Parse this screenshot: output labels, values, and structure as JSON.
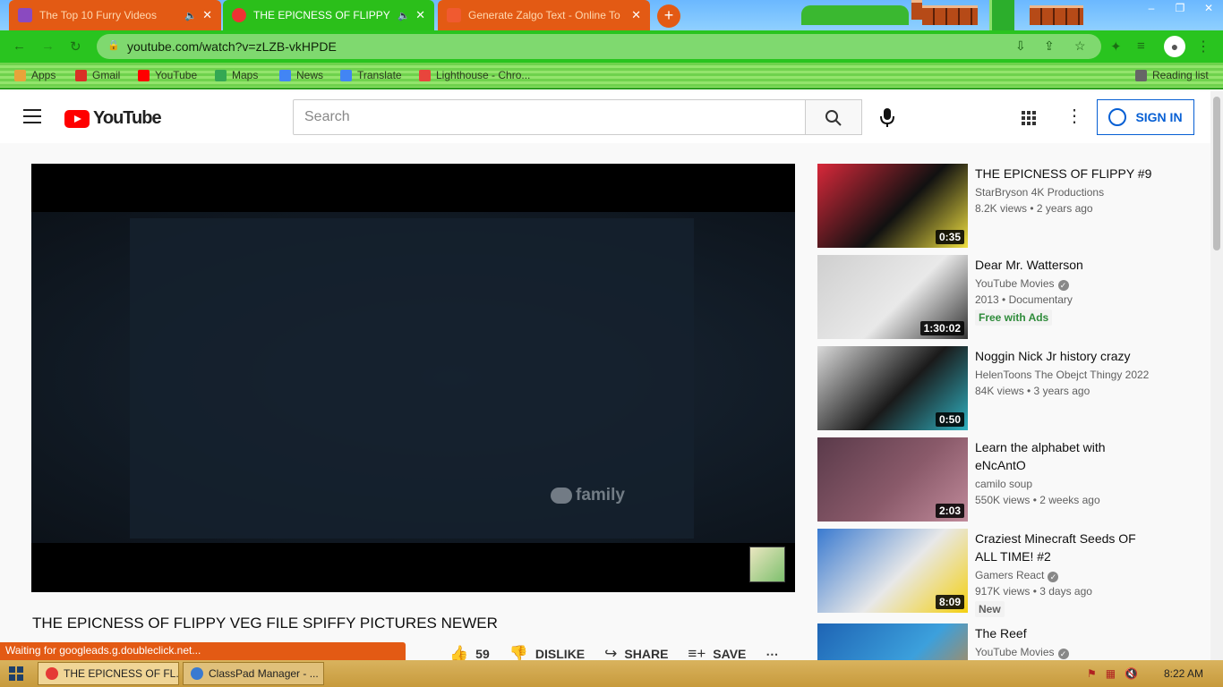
{
  "browser": {
    "tabs": [
      {
        "title": "The Top 10 Furry Videos",
        "audio": true
      },
      {
        "title": "THE EPICNESS OF FLIPPY VEG",
        "audio": true
      },
      {
        "title": "Generate Zalgo Text - Online To"
      }
    ],
    "new_tab_symbol": "+",
    "window_controls": {
      "minimize": "–",
      "restore": "❐",
      "close": "✕"
    },
    "url": "youtube.com/watch?v=zLZB-vkHPDE",
    "bookmarks": [
      {
        "label": "Apps",
        "color": "#e8a33a"
      },
      {
        "label": "Gmail",
        "color": "#d93025"
      },
      {
        "label": "YouTube",
        "color": "#ff0000"
      },
      {
        "label": "Maps",
        "color": "#34a853"
      },
      {
        "label": "News",
        "color": "#4285f4"
      },
      {
        "label": "Translate",
        "color": "#4285f4"
      },
      {
        "label": "Lighthouse - Chro...",
        "color": "#e8453c"
      }
    ],
    "reading_list": "Reading list",
    "status_text": "Waiting for googleads.g.doubleclick.net..."
  },
  "youtube": {
    "logo_text": "YouTube",
    "search_placeholder": "Search",
    "sign_in": "SIGN IN",
    "watermark": "family",
    "video_title": "THE EPICNESS OF FLIPPY VEG FILE SPIFFY PICTURES NEWER",
    "likes": "59",
    "dislike": "DISLIKE",
    "share": "SHARE",
    "save": "SAVE",
    "more": "⋯"
  },
  "recommendations": [
    {
      "title": "THE EPICNESS OF FLIPPY #9",
      "channel": "StarBryson 4K Productions",
      "meta": "8.2K views • 2 years ago",
      "duration": "0:35",
      "verified": false,
      "colors": [
        "#d8283a",
        "#111111",
        "#f0e040"
      ]
    },
    {
      "title": "Dear Mr. Watterson",
      "channel": "YouTube Movies",
      "meta": "2013 • Documentary",
      "badge": "Free with Ads",
      "duration": "1:30:02",
      "verified": true,
      "colors": [
        "#cfcfcf",
        "#e9e9e9",
        "#333333"
      ]
    },
    {
      "title": "Noggin Nick Jr history crazy",
      "channel": "HelenToons The Obejct Thingy 2022",
      "meta": "84K views • 3 years ago",
      "duration": "0:50",
      "verified": false,
      "colors": [
        "#dadada",
        "#1a1a1a",
        "#2fb0c0"
      ]
    },
    {
      "title": "Learn the alphabet with eNcAntO",
      "channel": "camilo soup",
      "meta": "550K views • 2 weeks ago",
      "duration": "2:03",
      "verified": false,
      "colors": [
        "#5a3a4a",
        "#8a5a6a",
        "#c08a9a"
      ]
    },
    {
      "title": "Craziest Minecraft Seeds OF ALL TIME! #2",
      "channel": "Gamers React",
      "meta": "917K views • 3 days ago",
      "badge": "New",
      "duration": "8:09",
      "verified": true,
      "colors": [
        "#3a7ad0",
        "#e8e8e8",
        "#f4d010"
      ]
    },
    {
      "title": "The Reef",
      "channel": "YouTube Movies",
      "meta": "",
      "duration": "",
      "verified": true,
      "colors": [
        "#1e64b4",
        "#3ca0dc",
        "#e08020"
      ]
    }
  ],
  "taskbar": {
    "items": [
      {
        "label": "THE EPICNESS OF FL...",
        "icon_color": "#e53935"
      },
      {
        "label": "ClassPad Manager - ...",
        "icon_color": "#3a7ad0"
      }
    ],
    "clock": "8:22 AM",
    "tray_icons": [
      "network-icon",
      "volume-icon",
      "flag-icon"
    ]
  }
}
